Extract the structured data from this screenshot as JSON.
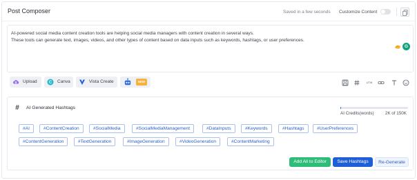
{
  "header": {
    "title": "Post Composer",
    "saved_status": "Saved in a few seconds",
    "customize_label": "Customize Content"
  },
  "editor": {
    "line1": "AI-powered social media content creation tools are helping social media managers with content creation in several ways.",
    "line2": "These tools can generate text, images, videos, and other types of content based on data inputs such as keywords, hashtags, or user preferences.",
    "avatar_letter": "G"
  },
  "toolbar": {
    "upload": "Upload",
    "canva": "Canva",
    "vista": "Vista Create",
    "new_badge": "NEW",
    "right_icons": [
      "save-icon",
      "hash-icon",
      "utm-icon",
      "link-icon",
      "text-icon",
      "emoji-icon"
    ],
    "utm": "UTM"
  },
  "hashtags": {
    "title": "AI Generated Hashtags",
    "credits_label": "AI Credits(words)",
    "credits_value": "2K of 150K",
    "credits_fraction": 0.013,
    "row1": [
      "#AI",
      "#ContentCreation",
      "#SocialMedia",
      "#SocialMediaManagement",
      "#DataInputs",
      "#Keywords",
      "#Hashtags",
      "#UserPreferences"
    ],
    "row2": [
      "#ContentGeneration",
      "#TextGeneration",
      "#ImageGeneration",
      "#VideoGeneration",
      "#ContentMarketing"
    ]
  },
  "actions": {
    "add_all": "Add All to Editor",
    "save": "Save Hashtags",
    "regenerate": "Re-Generate"
  },
  "colors": {
    "primary": "#1f5fd6",
    "success": "#2ebd79",
    "tag_border": "#a9c1ee",
    "tag_text": "#2a5fc9"
  }
}
